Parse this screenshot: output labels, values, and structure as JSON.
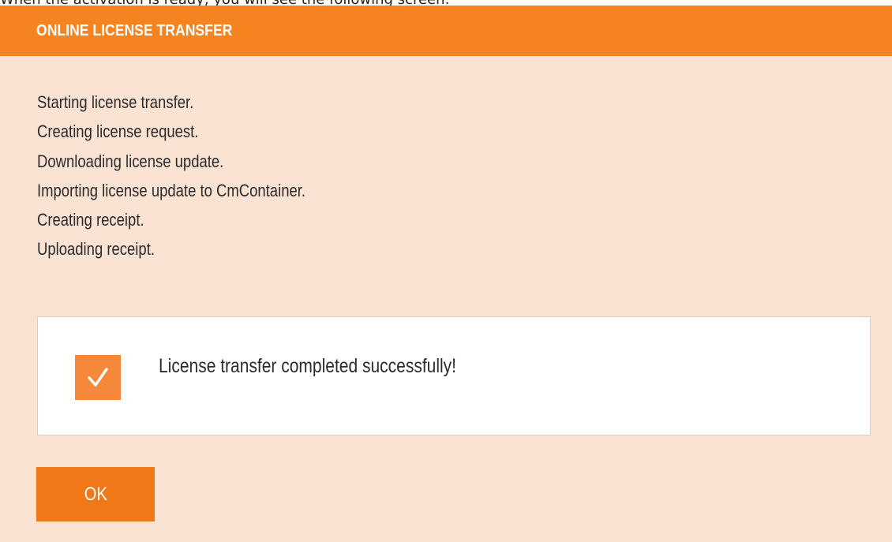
{
  "intro_text": "When the activation is ready, you will see the following screen:",
  "dialog": {
    "title": "ONLINE LICENSE TRANSFER",
    "log_lines": [
      "Starting license transfer.",
      "Creating license request.",
      "Downloading license update.",
      "Importing license update to CmContainer.",
      "Creating receipt.",
      "Uploading receipt."
    ],
    "status": {
      "icon": "checkmark-icon",
      "message": "License transfer completed successfully!"
    },
    "ok_label": "OK"
  },
  "colors": {
    "header": "#f58420",
    "dialog_background": "#fbe3d4",
    "button": "#f07818",
    "check_tile": "#f5883a"
  }
}
